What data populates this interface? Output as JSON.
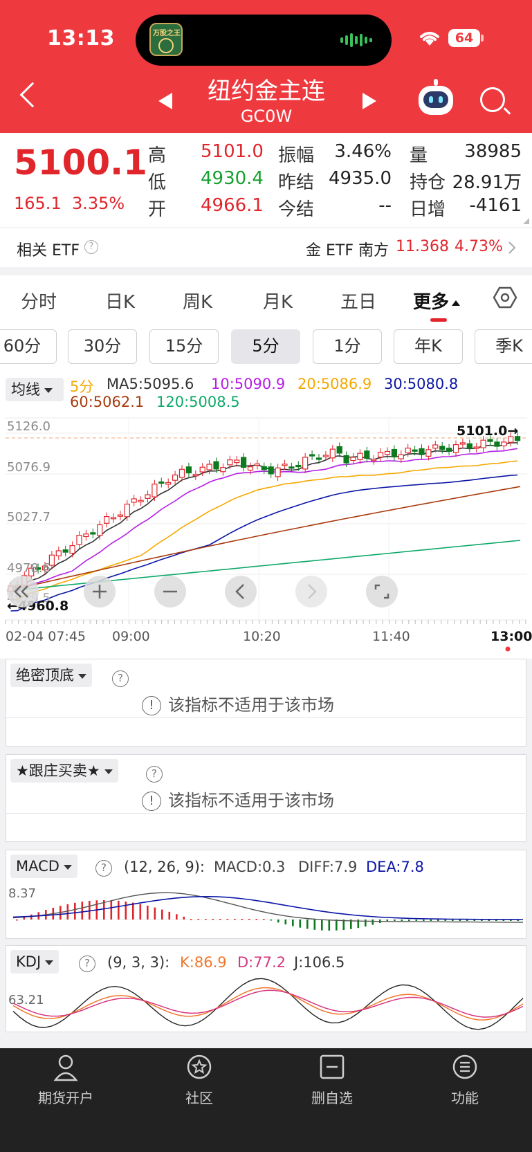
{
  "status": {
    "time": "13:13",
    "battery": "64",
    "island_app": "万股之王"
  },
  "header": {
    "title": "纽约金主连",
    "code": "GC0W"
  },
  "quote": {
    "price": "5100.1",
    "change": "165.1",
    "change_pct": "3.35%",
    "items": [
      {
        "label": "高",
        "value": "5101.0"
      },
      {
        "label": "低",
        "value": "4930.4"
      },
      {
        "label": "开",
        "value": "4966.1"
      },
      {
        "label": "振幅",
        "value": "3.46%"
      },
      {
        "label": "昨结",
        "value": "4935.0"
      },
      {
        "label": "今结",
        "value": "--"
      },
      {
        "label": "量",
        "value": "38985"
      },
      {
        "label": "持仓",
        "value": "28.91万"
      },
      {
        "label": "日增",
        "value": "-4161"
      }
    ]
  },
  "etf": {
    "label": "相关 ETF",
    "name": "金 ETF 南方",
    "price": "11.368",
    "pct": "4.73%"
  },
  "tabs": [
    "分时",
    "日K",
    "周K",
    "月K",
    "五日",
    "更多"
  ],
  "periods": [
    "60分",
    "30分",
    "15分",
    "5分",
    "1分",
    "年K",
    "季K"
  ],
  "ma": {
    "selector": "均线",
    "period": "5分",
    "ma5": "MA5:5095.6",
    "ma10": "10:5090.9",
    "ma20": "20:5086.9",
    "ma30": "30:5080.8",
    "ma60": "60:5062.1",
    "ma120": "120:5008.5"
  },
  "chart": {
    "y_labels": [
      "5126.0",
      "5076.9",
      "5027.7",
      "4978.6",
      "4929.5"
    ],
    "high_marker": "5101.0→",
    "low_marker": "←4960.8",
    "x_labels": [
      "02-04 07:45",
      "09:00",
      "10:20",
      "11:40",
      "13:00"
    ]
  },
  "colors": {
    "ma5": "#333333",
    "ma10": "#b61ee6",
    "ma20": "#f5a800",
    "ma30": "#0a15a6",
    "ma60": "#a83a0c",
    "ma120": "#0da86a",
    "up": "#e0252b",
    "down": "#0e7a1e"
  },
  "sub1": {
    "name": "绝密顶底",
    "message": "该指标不适用于该市场"
  },
  "sub2": {
    "name": "★跟庄买卖★",
    "message": "该指标不适用于该市场"
  },
  "macd": {
    "name": "MACD",
    "params": "(12, 26, 9):",
    "macd": "MACD:0.3",
    "diff": "DIFF:7.9",
    "dea": "DEA:7.8",
    "scale": "8.37"
  },
  "kdj": {
    "name": "KDJ",
    "params": "(9, 3, 3):",
    "k": "K:86.9",
    "d": "D:77.2",
    "j": "J:106.5",
    "scale": "63.21"
  },
  "bottom_nav": [
    "期货开户",
    "社区",
    "删自选",
    "功能"
  ]
}
